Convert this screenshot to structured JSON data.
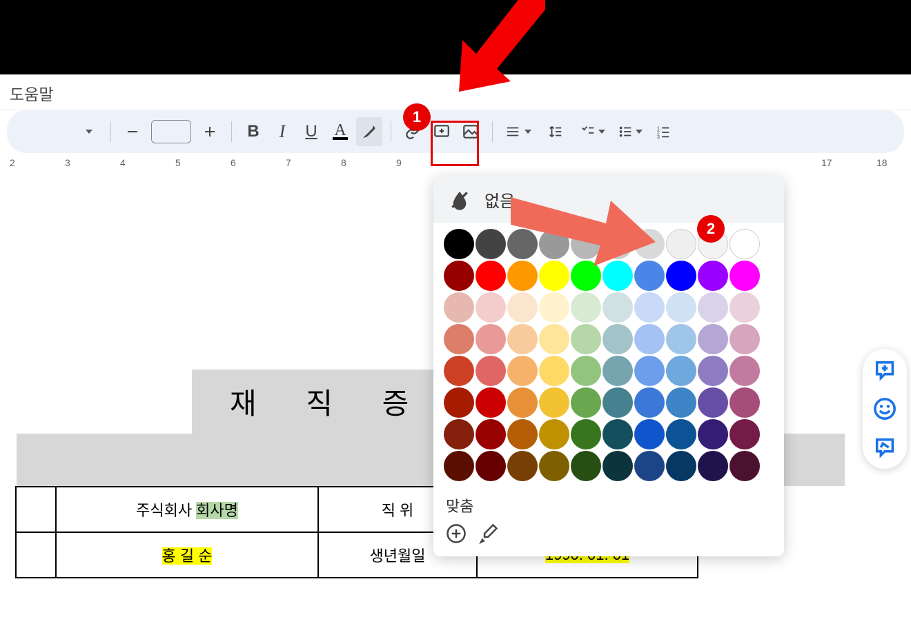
{
  "menubar": {
    "help": "도움말"
  },
  "toolbar": {
    "bold": "B",
    "italic": "I",
    "underline": "U",
    "text_color": "A"
  },
  "ruler": {
    "numbers": [
      2,
      3,
      4,
      5,
      6,
      7,
      8,
      9,
      17,
      18
    ]
  },
  "document": {
    "title": "재 직 증 명 서",
    "table": {
      "rows": [
        {
          "c1": "주식회사 ",
          "c1_hl": "회사명",
          "c2": "직 위"
        },
        {
          "c1_hl": "홍 길 순",
          "c2": "생년월일",
          "c3_hl": "1990. 01. 01"
        }
      ]
    }
  },
  "color_popup": {
    "none_label": "없음",
    "custom_label": "맞춤",
    "colors": {
      "row0": [
        "#000000",
        "#434343",
        "#666666",
        "#999999",
        "#b7b7b7",
        "#cccccc",
        "#d9d9d9",
        "#efefef",
        "#f3f3f3",
        "#ffffff"
      ],
      "row1": [
        "#980000",
        "#ff0000",
        "#ff9900",
        "#ffff00",
        "#00ff00",
        "#00ffff",
        "#4a86e8",
        "#0000ff",
        "#9900ff",
        "#ff00ff"
      ],
      "row2": [
        "#e6b8af",
        "#f4cccc",
        "#fce5cd",
        "#fff2cc",
        "#d9ead3",
        "#d0e0e3",
        "#c9daf8",
        "#cfe2f3",
        "#d9d2e9",
        "#ead1dc"
      ],
      "row3": [
        "#dd7e6b",
        "#ea9999",
        "#f9cb9c",
        "#ffe599",
        "#b6d7a8",
        "#a2c4c9",
        "#a4c2f4",
        "#9fc5e8",
        "#b4a7d6",
        "#d5a6bd"
      ],
      "row4": [
        "#cc4125",
        "#e06666",
        "#f6b26b",
        "#ffd966",
        "#93c47d",
        "#76a5af",
        "#6d9eeb",
        "#6fa8dc",
        "#8e7cc3",
        "#c27ba0"
      ],
      "row5": [
        "#a61c00",
        "#cc0000",
        "#e69138",
        "#f1c232",
        "#6aa84f",
        "#45818e",
        "#3c78d8",
        "#3d85c6",
        "#674ea7",
        "#a64d79"
      ],
      "row6": [
        "#85200c",
        "#990000",
        "#b45f06",
        "#bf9000",
        "#38761d",
        "#134f5c",
        "#1155cc",
        "#0b5394",
        "#351c75",
        "#741b47"
      ],
      "row7": [
        "#5b0f00",
        "#660000",
        "#783f04",
        "#7f6000",
        "#274e13",
        "#0c343d",
        "#1c4587",
        "#073763",
        "#20124d",
        "#4c1130"
      ]
    }
  },
  "annotations": {
    "badge1": "1",
    "badge2": "2"
  }
}
